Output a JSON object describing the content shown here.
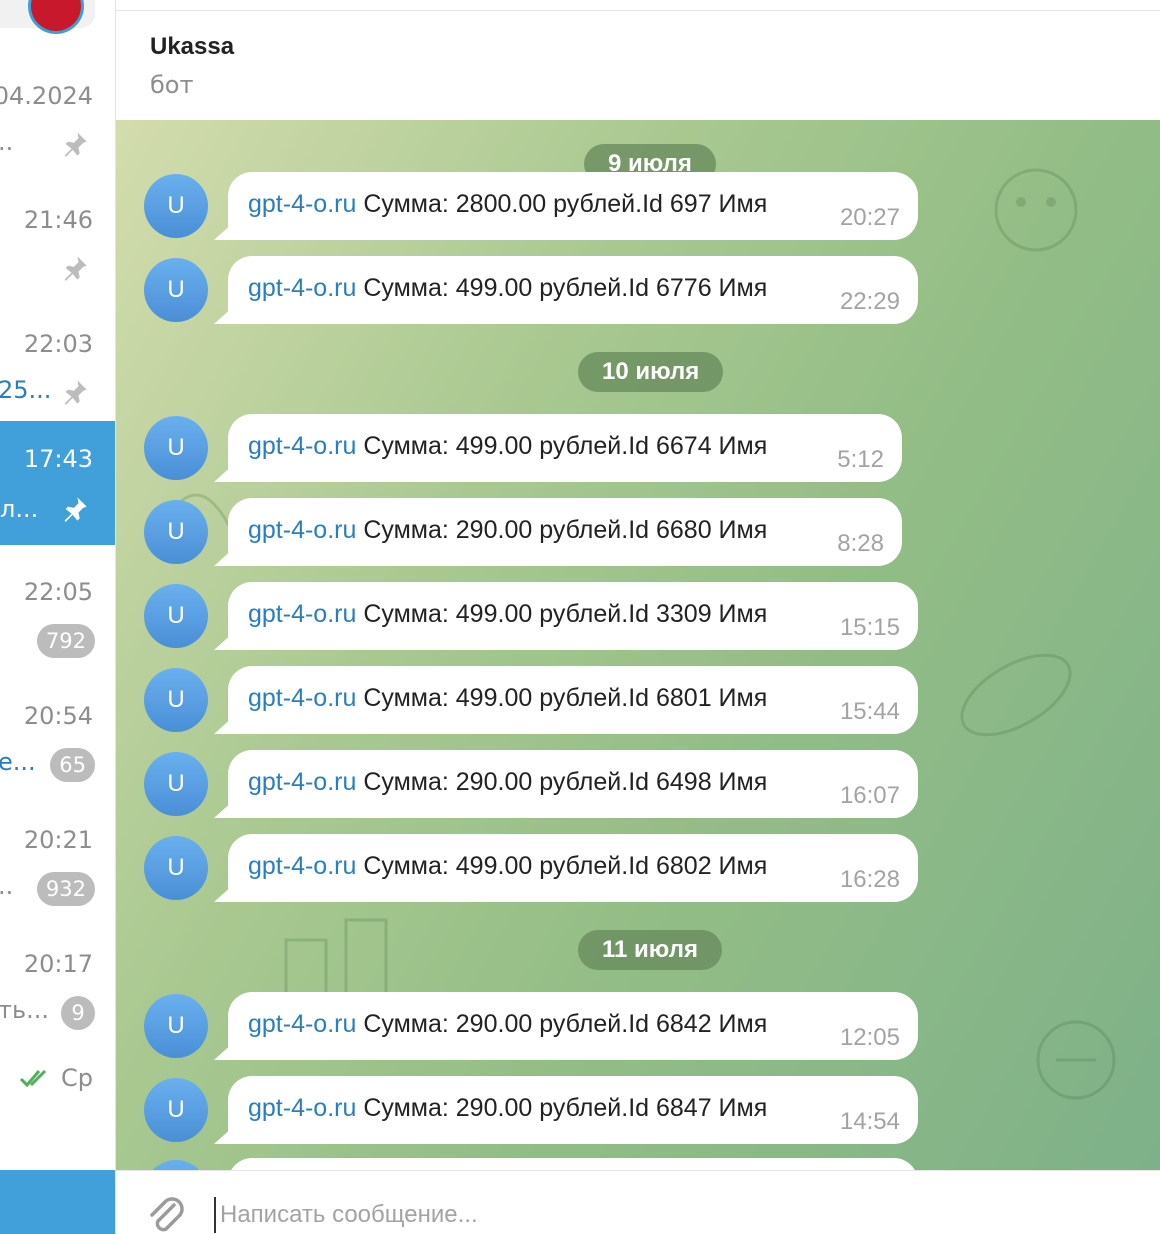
{
  "sidebar": {
    "chats": [
      {
        "time": "04.2024",
        "snippet": "..",
        "pinned": true,
        "badge": ""
      },
      {
        "time": "21:46",
        "snippet": "",
        "pinned": true,
        "badge": ""
      },
      {
        "time": "22:03",
        "snippet": "25...",
        "pinned": true,
        "badge": ""
      },
      {
        "time": "17:43",
        "snippet": "л...",
        "pinned": true,
        "badge": "",
        "active": true
      },
      {
        "time": "22:05",
        "snippet": "",
        "pinned": false,
        "badge": "792"
      },
      {
        "time": "20:54",
        "snippet": "е...",
        "pinned": false,
        "badge": "65"
      },
      {
        "time": "20:21",
        "snippet": "..",
        "pinned": false,
        "badge": "932"
      },
      {
        "time": "20:17",
        "snippet": "ть...",
        "pinned": false,
        "badge": "9"
      }
    ],
    "last_time": "Ср"
  },
  "header": {
    "title": "Ukassa",
    "status": "бот"
  },
  "messages": {
    "avatar_letter": "U",
    "link_text": "gpt-4-o.ru",
    "items": [
      {
        "text": " Сумма: 2800.00 рублей.Id 697 Имя",
        "time": "20:27"
      },
      {
        "text": " Сумма: 499.00 рублей.Id 6776 Имя",
        "time": "22:29"
      },
      {
        "text": " Сумма: 499.00 рублей.Id 6674 Имя",
        "time": "5:12"
      },
      {
        "text": " Сумма: 290.00 рублей.Id 6680 Имя",
        "time": "8:28"
      },
      {
        "text": " Сумма: 499.00 рублей.Id 3309 Имя",
        "time": "15:15"
      },
      {
        "text": " Сумма: 499.00 рублей.Id 6801 Имя",
        "time": "15:44"
      },
      {
        "text": " Сумма: 290.00 рублей.Id 6498 Имя",
        "time": "16:07"
      },
      {
        "text": " Сумма: 499.00 рублей.Id 6802 Имя",
        "time": "16:28"
      },
      {
        "text": " Сумма: 290.00 рублей.Id 6842 Имя",
        "time": "12:05"
      },
      {
        "text": " Сумма: 290.00 рублей.Id 6847 Имя",
        "time": "14:54"
      }
    ]
  },
  "dates": [
    "9 июля",
    "10 июля",
    "11 июля"
  ],
  "composer": {
    "placeholder": "Написать сообщение..."
  },
  "colors": {
    "accent": "#419fd9",
    "link": "#2a7ec0",
    "badge": "#bcbcbc",
    "avatar": "#4a8fd6"
  },
  "icons": {
    "pin": "pin-icon",
    "double_check": "double-check-icon",
    "attach": "paperclip-icon"
  }
}
